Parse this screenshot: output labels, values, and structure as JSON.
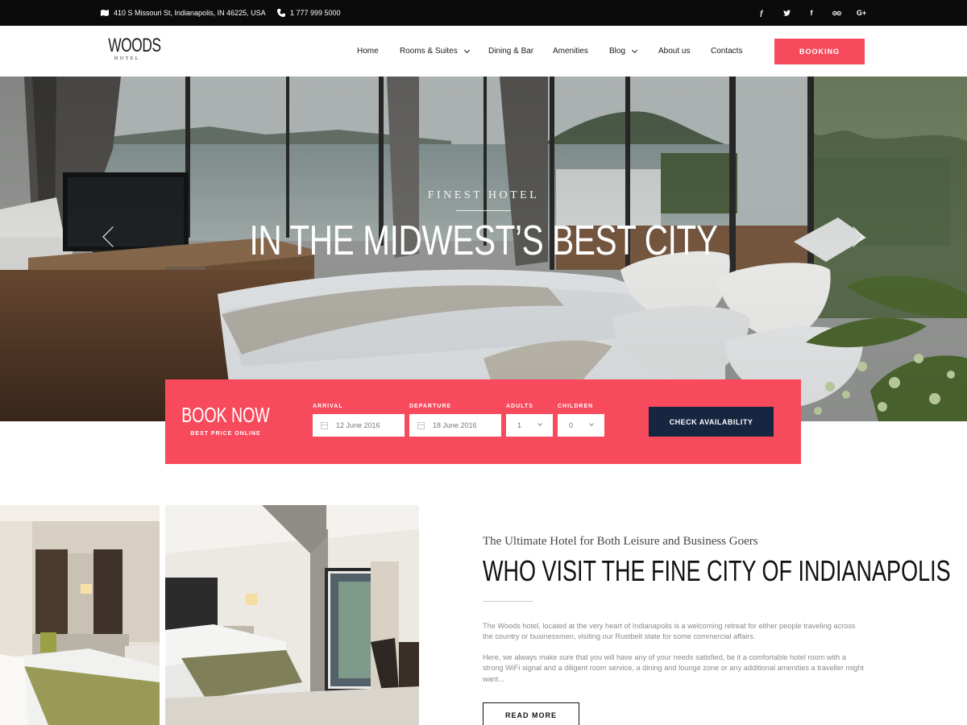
{
  "topbar": {
    "address": "410 S Missouri St, Indianapolis, IN 46225, USA",
    "phone": "1 777 999 5000",
    "social": [
      "foursquare-icon",
      "twitter-icon",
      "facebook-icon",
      "tripadvisor-icon",
      "google-plus-icon"
    ]
  },
  "header": {
    "logo_name": "WOODS",
    "logo_sub": "HOTEL",
    "nav": [
      "Home",
      "Rooms & Suites",
      "Dining & Bar",
      "Amenities",
      "Blog",
      "About us",
      "Contacts"
    ],
    "booking_label": "BOOKING"
  },
  "hero": {
    "eyebrow": "FINEST HOTEL",
    "headline": "IN THE MIDWEST’S BEST CITY"
  },
  "booking_form": {
    "title": "BOOK NOW",
    "subtitle": "BEST PRICE ONLINE",
    "arrival_label": "ARRIVAL",
    "arrival_value": "12 June 2016",
    "departure_label": "DEPARTURE",
    "departure_value": "18 June 2016",
    "adults_label": "ADULTS",
    "adults_value": "1",
    "children_label": "CHILDREN",
    "children_value": "0",
    "submit_label": "CHECK AVAILABILITY"
  },
  "about": {
    "kicker": "The Ultimate Hotel for Both Leisure and Business Goers",
    "title": "WHO VISIT THE FINE CITY OF INDIANAPOLIS",
    "paragraph1": "The Woods hotel, located at the very heart of Indianapolis is a welcoming retreat for either people traveling across the country or businessmen, visiting our Rustbelt state for some commercial affairs.",
    "paragraph2": "Here, we always make sure that you will have any of your needs satisfied, be it a comfortable hotel room with a strong WiFi signal and a diligent room service, a dining and lounge zone or any additional amenities a traveller might want...",
    "read_more": "READ MORE"
  },
  "colors": {
    "accent": "#f74a5c",
    "dark_navy": "#162640",
    "topbar_bg": "#0b0b0b"
  }
}
